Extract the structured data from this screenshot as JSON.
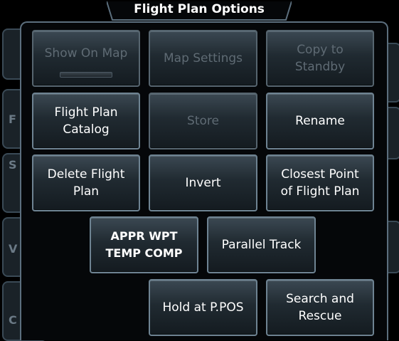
{
  "title": "Flight Plan Options",
  "background_letters": [
    "F",
    "S",
    "V",
    "C"
  ],
  "buttons": [
    {
      "id": "show-on-map",
      "label": "Show On Map",
      "enabled": false,
      "annunciator": true
    },
    {
      "id": "map-settings",
      "label": "Map Settings",
      "enabled": false
    },
    {
      "id": "copy-to-standby",
      "label": "Copy to\nStandby",
      "enabled": false
    },
    {
      "id": "flight-plan-catalog",
      "label": "Flight Plan\nCatalog",
      "enabled": true
    },
    {
      "id": "store",
      "label": "Store",
      "enabled": false
    },
    {
      "id": "rename",
      "label": "Rename",
      "enabled": true
    },
    {
      "id": "delete-flight-plan",
      "label": "Delete Flight\nPlan",
      "enabled": true
    },
    {
      "id": "invert",
      "label": "Invert",
      "enabled": true
    },
    {
      "id": "closest-point",
      "label": "Closest Point\nof Flight Plan",
      "enabled": true
    },
    {
      "id": "appr-wpt-temp-comp",
      "label": "APPR WPT\nTEMP COMP",
      "enabled": true
    },
    {
      "id": "parallel-track",
      "label": "Parallel Track",
      "enabled": true
    },
    {
      "id": "hold-at-ppos",
      "label": "Hold at P.POS",
      "enabled": true
    },
    {
      "id": "search-and-rescue",
      "label": "Search and\nRescue",
      "enabled": true
    }
  ],
  "colors": {
    "enabled_text": "#ffffff",
    "disabled_text": "#5f6b74",
    "button_border": "#6e8392",
    "window_border": "#5c6f7e"
  }
}
